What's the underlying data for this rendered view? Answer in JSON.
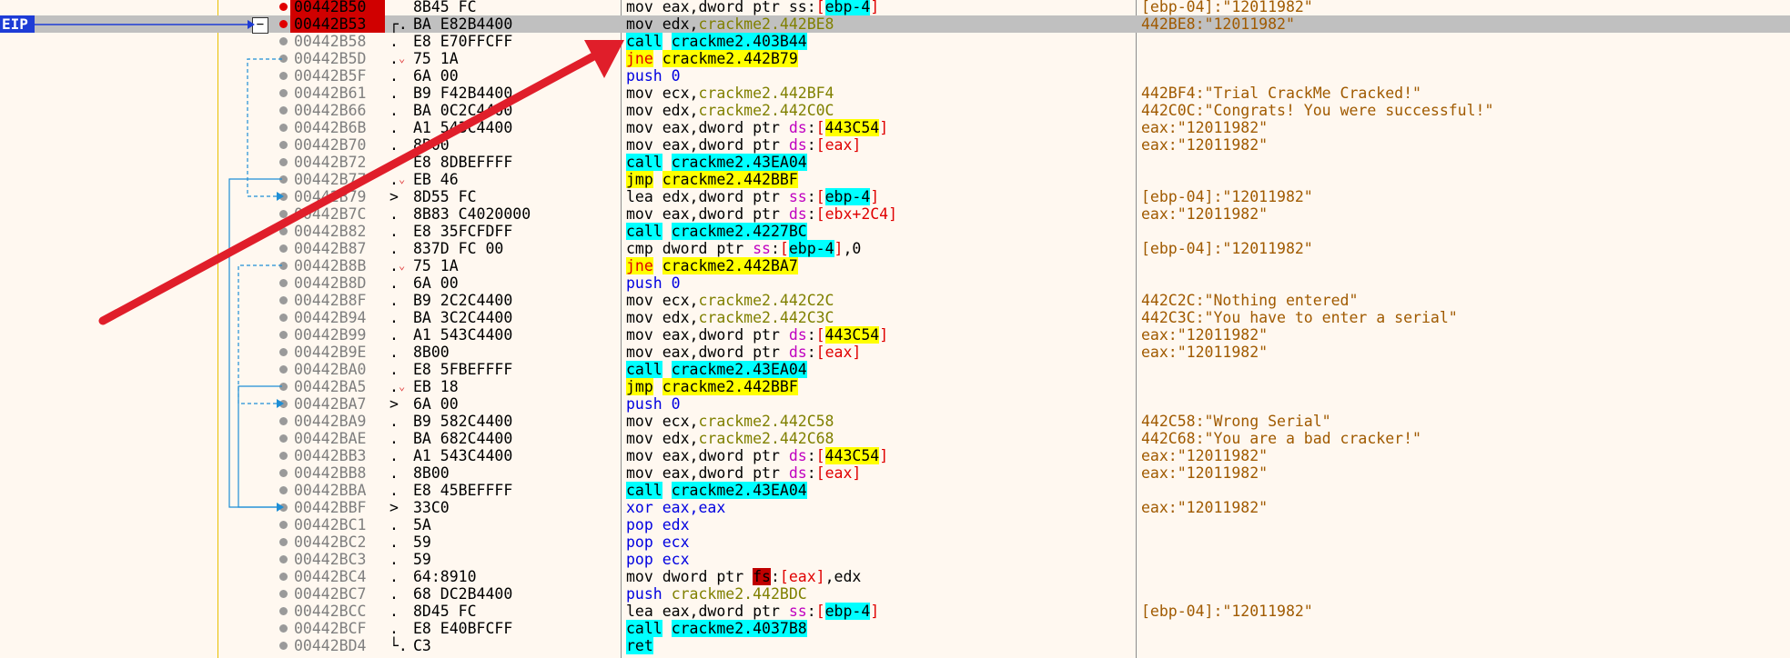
{
  "eip_label": "EIP",
  "collapse_symbol": "−",
  "rows": [
    {
      "addr": "00442B50",
      "bytes": "8B45 FC",
      "mark": "",
      "jump": false,
      "bp": "red",
      "hl": true,
      "sel": false,
      "ins": [
        [
          "mov",
          "mn-mov"
        ],
        [
          " eax,",
          ""
        ],
        [
          "dword ptr ",
          "ptr"
        ],
        [
          "ss",
          ""
        ],
        [
          ":",
          ""
        ],
        [
          "[",
          "regbr"
        ],
        [
          "ebp-4",
          "reg-c"
        ],
        [
          "]",
          "regbr"
        ]
      ],
      "cmt": "[ebp-04]:\"12011982\""
    },
    {
      "addr": "00442B53",
      "bytes": "BA E82B4400",
      "mark": "┌.",
      "jump": false,
      "bp": "red",
      "hl": true,
      "sel": true,
      "ins": [
        [
          "mov",
          "mn-mov"
        ],
        [
          " edx,",
          ""
        ],
        [
          "crackme2.442BE8",
          "opn"
        ]
      ],
      "cmt": "442BE8:\"12011982\""
    },
    {
      "addr": "00442B58",
      "bytes": "E8 E70FFCFF",
      "mark": ".",
      "jump": false,
      "bp": "gray",
      "hl": false,
      "sel": false,
      "ins": [
        [
          "call",
          "call"
        ],
        [
          " ",
          ""
        ],
        [
          "crackme2.403B44",
          "call"
        ]
      ],
      "cmt": ""
    },
    {
      "addr": "00442B5D",
      "bytes": "75 1A",
      "mark": ".",
      "jump": true,
      "bp": "gray",
      "hl": false,
      "sel": false,
      "ins": [
        [
          "jne",
          "jne"
        ],
        [
          " ",
          ""
        ],
        [
          "crackme2.442B79",
          "tgt"
        ]
      ],
      "cmt": ""
    },
    {
      "addr": "00442B5F",
      "bytes": "6A 00",
      "mark": ".",
      "jump": false,
      "bp": "gray",
      "hl": false,
      "sel": false,
      "ins": [
        [
          "push",
          "mn-push"
        ],
        [
          " 0",
          "mn-push"
        ]
      ],
      "cmt": ""
    },
    {
      "addr": "00442B61",
      "bytes": "B9 F42B4400",
      "mark": ".",
      "jump": false,
      "bp": "gray",
      "hl": false,
      "sel": false,
      "ins": [
        [
          "mov",
          "mn-mov"
        ],
        [
          " ecx,",
          ""
        ],
        [
          "crackme2.442BF4",
          "opn"
        ]
      ],
      "cmt": "442BF4:\"Trial CrackMe Cracked!\""
    },
    {
      "addr": "00442B66",
      "bytes": "BA 0C2C4400",
      "mark": ".",
      "jump": false,
      "bp": "gray",
      "hl": false,
      "sel": false,
      "ins": [
        [
          "mov",
          "mn-mov"
        ],
        [
          " edx,",
          ""
        ],
        [
          "crackme2.442C0C",
          "opn"
        ]
      ],
      "cmt": "442C0C:\"Congrats! You were successful!\""
    },
    {
      "addr": "00442B6B",
      "bytes": "A1 543C4400",
      "mark": ".",
      "jump": false,
      "bp": "gray",
      "hl": false,
      "sel": false,
      "ins": [
        [
          "mov",
          "mn-mov"
        ],
        [
          " eax,",
          ""
        ],
        [
          "dword ptr ",
          "ptr"
        ],
        [
          "ds",
          "seg"
        ],
        [
          ":",
          ""
        ],
        [
          "[",
          "regbr"
        ],
        [
          "443C54",
          "reg-y"
        ],
        [
          "]",
          "regbr"
        ]
      ],
      "cmt": "eax:\"12011982\""
    },
    {
      "addr": "00442B70",
      "bytes": "8B00",
      "mark": ".",
      "jump": false,
      "bp": "gray",
      "hl": false,
      "sel": false,
      "ins": [
        [
          "mov",
          "mn-mov"
        ],
        [
          " eax,",
          ""
        ],
        [
          "dword ptr ",
          "ptr"
        ],
        [
          "ds",
          "seg"
        ],
        [
          ":",
          ""
        ],
        [
          "[",
          "regbr"
        ],
        [
          "eax",
          "regbr"
        ],
        [
          "]",
          "regbr"
        ]
      ],
      "cmt": "eax:\"12011982\""
    },
    {
      "addr": "00442B72",
      "bytes": "E8 8DBEFFFF",
      "mark": ".",
      "jump": false,
      "bp": "gray",
      "hl": false,
      "sel": false,
      "ins": [
        [
          "call",
          "call"
        ],
        [
          " ",
          ""
        ],
        [
          "crackme2.43EA04",
          "call"
        ]
      ],
      "cmt": ""
    },
    {
      "addr": "00442B77",
      "bytes": "EB 46",
      "mark": ".",
      "jump": true,
      "bp": "gray",
      "hl": false,
      "sel": false,
      "ins": [
        [
          "jmp",
          "jmp"
        ],
        [
          " ",
          ""
        ],
        [
          "crackme2.442BBF",
          "tgt"
        ]
      ],
      "cmt": ""
    },
    {
      "addr": "00442B79",
      "bytes": "8D55 FC",
      "mark": ">",
      "jump": false,
      "bp": "gray",
      "hl": false,
      "sel": false,
      "ins": [
        [
          "lea",
          "mn-mov"
        ],
        [
          " edx,",
          ""
        ],
        [
          "dword ptr ",
          "ptr"
        ],
        [
          "ss",
          "seg"
        ],
        [
          ":",
          ""
        ],
        [
          "[",
          "regbr"
        ],
        [
          "ebp-4",
          "reg-c"
        ],
        [
          "]",
          "regbr"
        ]
      ],
      "cmt": "[ebp-04]:\"12011982\""
    },
    {
      "addr": "00442B7C",
      "bytes": "8B83 C4020000",
      "mark": ".",
      "jump": false,
      "bp": "gray",
      "hl": false,
      "sel": false,
      "ins": [
        [
          "mov",
          "mn-mov"
        ],
        [
          " eax,",
          ""
        ],
        [
          "dword ptr ",
          "ptr"
        ],
        [
          "ds",
          "seg"
        ],
        [
          ":",
          ""
        ],
        [
          "[",
          "regbr"
        ],
        [
          "ebx+2C4",
          "regbr"
        ],
        [
          "]",
          "regbr"
        ]
      ],
      "cmt": "eax:\"12011982\""
    },
    {
      "addr": "00442B82",
      "bytes": "E8 35FCFDFF",
      "mark": ".",
      "jump": false,
      "bp": "gray",
      "hl": false,
      "sel": false,
      "ins": [
        [
          "call",
          "call"
        ],
        [
          " ",
          ""
        ],
        [
          "crackme2.4227BC",
          "call"
        ]
      ],
      "cmt": ""
    },
    {
      "addr": "00442B87",
      "bytes": "837D FC 00",
      "mark": ".",
      "jump": false,
      "bp": "gray",
      "hl": false,
      "sel": false,
      "ins": [
        [
          "cmp",
          "mn-mov"
        ],
        [
          " dword ptr ",
          "ptr"
        ],
        [
          "ss",
          "seg"
        ],
        [
          ":",
          ""
        ],
        [
          "[",
          "regbr"
        ],
        [
          "ebp-4",
          "reg-c"
        ],
        [
          "]",
          "regbr"
        ],
        [
          ",0",
          ""
        ]
      ],
      "cmt": "[ebp-04]:\"12011982\""
    },
    {
      "addr": "00442B8B",
      "bytes": "75 1A",
      "mark": ".",
      "jump": true,
      "bp": "gray",
      "hl": false,
      "sel": false,
      "ins": [
        [
          "jne",
          "jne"
        ],
        [
          " ",
          ""
        ],
        [
          "crackme2.442BA7",
          "tgt"
        ]
      ],
      "cmt": ""
    },
    {
      "addr": "00442B8D",
      "bytes": "6A 00",
      "mark": ".",
      "jump": false,
      "bp": "gray",
      "hl": false,
      "sel": false,
      "ins": [
        [
          "push",
          "mn-push"
        ],
        [
          " 0",
          "mn-push"
        ]
      ],
      "cmt": ""
    },
    {
      "addr": "00442B8F",
      "bytes": "B9 2C2C4400",
      "mark": ".",
      "jump": false,
      "bp": "gray",
      "hl": false,
      "sel": false,
      "ins": [
        [
          "mov",
          "mn-mov"
        ],
        [
          " ecx,",
          ""
        ],
        [
          "crackme2.442C2C",
          "opn"
        ]
      ],
      "cmt": "442C2C:\"Nothing entered\""
    },
    {
      "addr": "00442B94",
      "bytes": "BA 3C2C4400",
      "mark": ".",
      "jump": false,
      "bp": "gray",
      "hl": false,
      "sel": false,
      "ins": [
        [
          "mov",
          "mn-mov"
        ],
        [
          " edx,",
          ""
        ],
        [
          "crackme2.442C3C",
          "opn"
        ]
      ],
      "cmt": "442C3C:\"You have to enter a serial\""
    },
    {
      "addr": "00442B99",
      "bytes": "A1 543C4400",
      "mark": ".",
      "jump": false,
      "bp": "gray",
      "hl": false,
      "sel": false,
      "ins": [
        [
          "mov",
          "mn-mov"
        ],
        [
          " eax,",
          ""
        ],
        [
          "dword ptr ",
          "ptr"
        ],
        [
          "ds",
          "seg"
        ],
        [
          ":",
          ""
        ],
        [
          "[",
          "regbr"
        ],
        [
          "443C54",
          "reg-y"
        ],
        [
          "]",
          "regbr"
        ]
      ],
      "cmt": "eax:\"12011982\""
    },
    {
      "addr": "00442B9E",
      "bytes": "8B00",
      "mark": ".",
      "jump": false,
      "bp": "gray",
      "hl": false,
      "sel": false,
      "ins": [
        [
          "mov",
          "mn-mov"
        ],
        [
          " eax,",
          ""
        ],
        [
          "dword ptr ",
          "ptr"
        ],
        [
          "ds",
          "seg"
        ],
        [
          ":",
          ""
        ],
        [
          "[",
          "regbr"
        ],
        [
          "eax",
          "regbr"
        ],
        [
          "]",
          "regbr"
        ]
      ],
      "cmt": "eax:\"12011982\""
    },
    {
      "addr": "00442BA0",
      "bytes": "E8 5FBEFFFF",
      "mark": ".",
      "jump": false,
      "bp": "gray",
      "hl": false,
      "sel": false,
      "ins": [
        [
          "call",
          "call"
        ],
        [
          " ",
          ""
        ],
        [
          "crackme2.43EA04",
          "call"
        ]
      ],
      "cmt": ""
    },
    {
      "addr": "00442BA5",
      "bytes": "EB 18",
      "mark": ".",
      "jump": true,
      "bp": "gray",
      "hl": false,
      "sel": false,
      "ins": [
        [
          "jmp",
          "jmp"
        ],
        [
          " ",
          ""
        ],
        [
          "crackme2.442BBF",
          "tgt"
        ]
      ],
      "cmt": ""
    },
    {
      "addr": "00442BA7",
      "bytes": "6A 00",
      "mark": ">",
      "jump": false,
      "bp": "gray",
      "hl": false,
      "sel": false,
      "ins": [
        [
          "push",
          "mn-push"
        ],
        [
          " 0",
          "mn-push"
        ]
      ],
      "cmt": ""
    },
    {
      "addr": "00442BA9",
      "bytes": "B9 582C4400",
      "mark": ".",
      "jump": false,
      "bp": "gray",
      "hl": false,
      "sel": false,
      "ins": [
        [
          "mov",
          "mn-mov"
        ],
        [
          " ecx,",
          ""
        ],
        [
          "crackme2.442C58",
          "opn"
        ]
      ],
      "cmt": "442C58:\"Wrong Serial\""
    },
    {
      "addr": "00442BAE",
      "bytes": "BA 682C4400",
      "mark": ".",
      "jump": false,
      "bp": "gray",
      "hl": false,
      "sel": false,
      "ins": [
        [
          "mov",
          "mn-mov"
        ],
        [
          " edx,",
          ""
        ],
        [
          "crackme2.442C68",
          "opn"
        ]
      ],
      "cmt": "442C68:\"You are a bad cracker!\""
    },
    {
      "addr": "00442BB3",
      "bytes": "A1 543C4400",
      "mark": ".",
      "jump": false,
      "bp": "gray",
      "hl": false,
      "sel": false,
      "ins": [
        [
          "mov",
          "mn-mov"
        ],
        [
          " eax,",
          ""
        ],
        [
          "dword ptr ",
          "ptr"
        ],
        [
          "ds",
          "seg"
        ],
        [
          ":",
          ""
        ],
        [
          "[",
          "regbr"
        ],
        [
          "443C54",
          "reg-y"
        ],
        [
          "]",
          "regbr"
        ]
      ],
      "cmt": "eax:\"12011982\""
    },
    {
      "addr": "00442BB8",
      "bytes": "8B00",
      "mark": ".",
      "jump": false,
      "bp": "gray",
      "hl": false,
      "sel": false,
      "ins": [
        [
          "mov",
          "mn-mov"
        ],
        [
          " eax,",
          ""
        ],
        [
          "dword ptr ",
          "ptr"
        ],
        [
          "ds",
          "seg"
        ],
        [
          ":",
          ""
        ],
        [
          "[",
          "regbr"
        ],
        [
          "eax",
          "regbr"
        ],
        [
          "]",
          "regbr"
        ]
      ],
      "cmt": "eax:\"12011982\""
    },
    {
      "addr": "00442BBA",
      "bytes": "E8 45BEFFFF",
      "mark": ".",
      "jump": false,
      "bp": "gray",
      "hl": false,
      "sel": false,
      "ins": [
        [
          "call",
          "call"
        ],
        [
          " ",
          ""
        ],
        [
          "crackme2.43EA04",
          "call"
        ]
      ],
      "cmt": ""
    },
    {
      "addr": "00442BBF",
      "bytes": "33C0",
      "mark": ">",
      "jump": false,
      "bp": "gray",
      "hl": false,
      "sel": false,
      "ins": [
        [
          "xor",
          "mn-xor"
        ],
        [
          " eax,eax",
          "mn-xor"
        ]
      ],
      "cmt": "eax:\"12011982\""
    },
    {
      "addr": "00442BC1",
      "bytes": "5A",
      "mark": ".",
      "jump": false,
      "bp": "gray",
      "hl": false,
      "sel": false,
      "ins": [
        [
          "pop",
          "mn-pop"
        ],
        [
          " edx",
          "mn-pop"
        ]
      ],
      "cmt": ""
    },
    {
      "addr": "00442BC2",
      "bytes": "59",
      "mark": ".",
      "jump": false,
      "bp": "gray",
      "hl": false,
      "sel": false,
      "ins": [
        [
          "pop",
          "mn-pop"
        ],
        [
          " ecx",
          "mn-pop"
        ]
      ],
      "cmt": ""
    },
    {
      "addr": "00442BC3",
      "bytes": "59",
      "mark": ".",
      "jump": false,
      "bp": "gray",
      "hl": false,
      "sel": false,
      "ins": [
        [
          "pop",
          "mn-pop"
        ],
        [
          " ecx",
          "mn-pop"
        ]
      ],
      "cmt": ""
    },
    {
      "addr": "00442BC4",
      "bytes": "64:8910",
      "mark": ".",
      "jump": false,
      "bp": "gray",
      "hl": false,
      "sel": false,
      "ins": [
        [
          "mov",
          "mn-mov"
        ],
        [
          " dword ptr ",
          "ptr"
        ],
        [
          "fs",
          "fs"
        ],
        [
          ":",
          ""
        ],
        [
          "[",
          "regbr"
        ],
        [
          "eax",
          "regbr"
        ],
        [
          "]",
          "regbr"
        ],
        [
          ",edx",
          ""
        ]
      ],
      "cmt": ""
    },
    {
      "addr": "00442BC7",
      "bytes": "68 DC2B4400",
      "mark": ".",
      "jump": false,
      "bp": "gray",
      "hl": false,
      "sel": false,
      "ins": [
        [
          "push",
          "mn-push"
        ],
        [
          " ",
          ""
        ],
        [
          "crackme2.442BDC",
          "opn"
        ]
      ],
      "cmt": ""
    },
    {
      "addr": "00442BCC",
      "bytes": "8D45 FC",
      "mark": ".",
      "jump": false,
      "bp": "gray",
      "hl": false,
      "sel": false,
      "ins": [
        [
          "lea",
          "mn-mov"
        ],
        [
          " eax,",
          ""
        ],
        [
          "dword ptr ",
          "ptr"
        ],
        [
          "ss",
          "seg"
        ],
        [
          ":",
          ""
        ],
        [
          "[",
          "regbr"
        ],
        [
          "ebp-4",
          "reg-c"
        ],
        [
          "]",
          "regbr"
        ]
      ],
      "cmt": "[ebp-04]:\"12011982\""
    },
    {
      "addr": "00442BCF",
      "bytes": "E8 E40BFCFF",
      "mark": ".",
      "jump": false,
      "bp": "gray",
      "hl": false,
      "sel": false,
      "ins": [
        [
          "call",
          "call"
        ],
        [
          " ",
          ""
        ],
        [
          "crackme2.4037B8",
          "call"
        ]
      ],
      "cmt": ""
    },
    {
      "addr": "00442BD4",
      "bytes": "C3",
      "mark": "└.",
      "jump": false,
      "bp": "gray",
      "hl": false,
      "sel": false,
      "ins": [
        [
          "ret",
          "ret"
        ]
      ],
      "cmt": ""
    }
  ]
}
